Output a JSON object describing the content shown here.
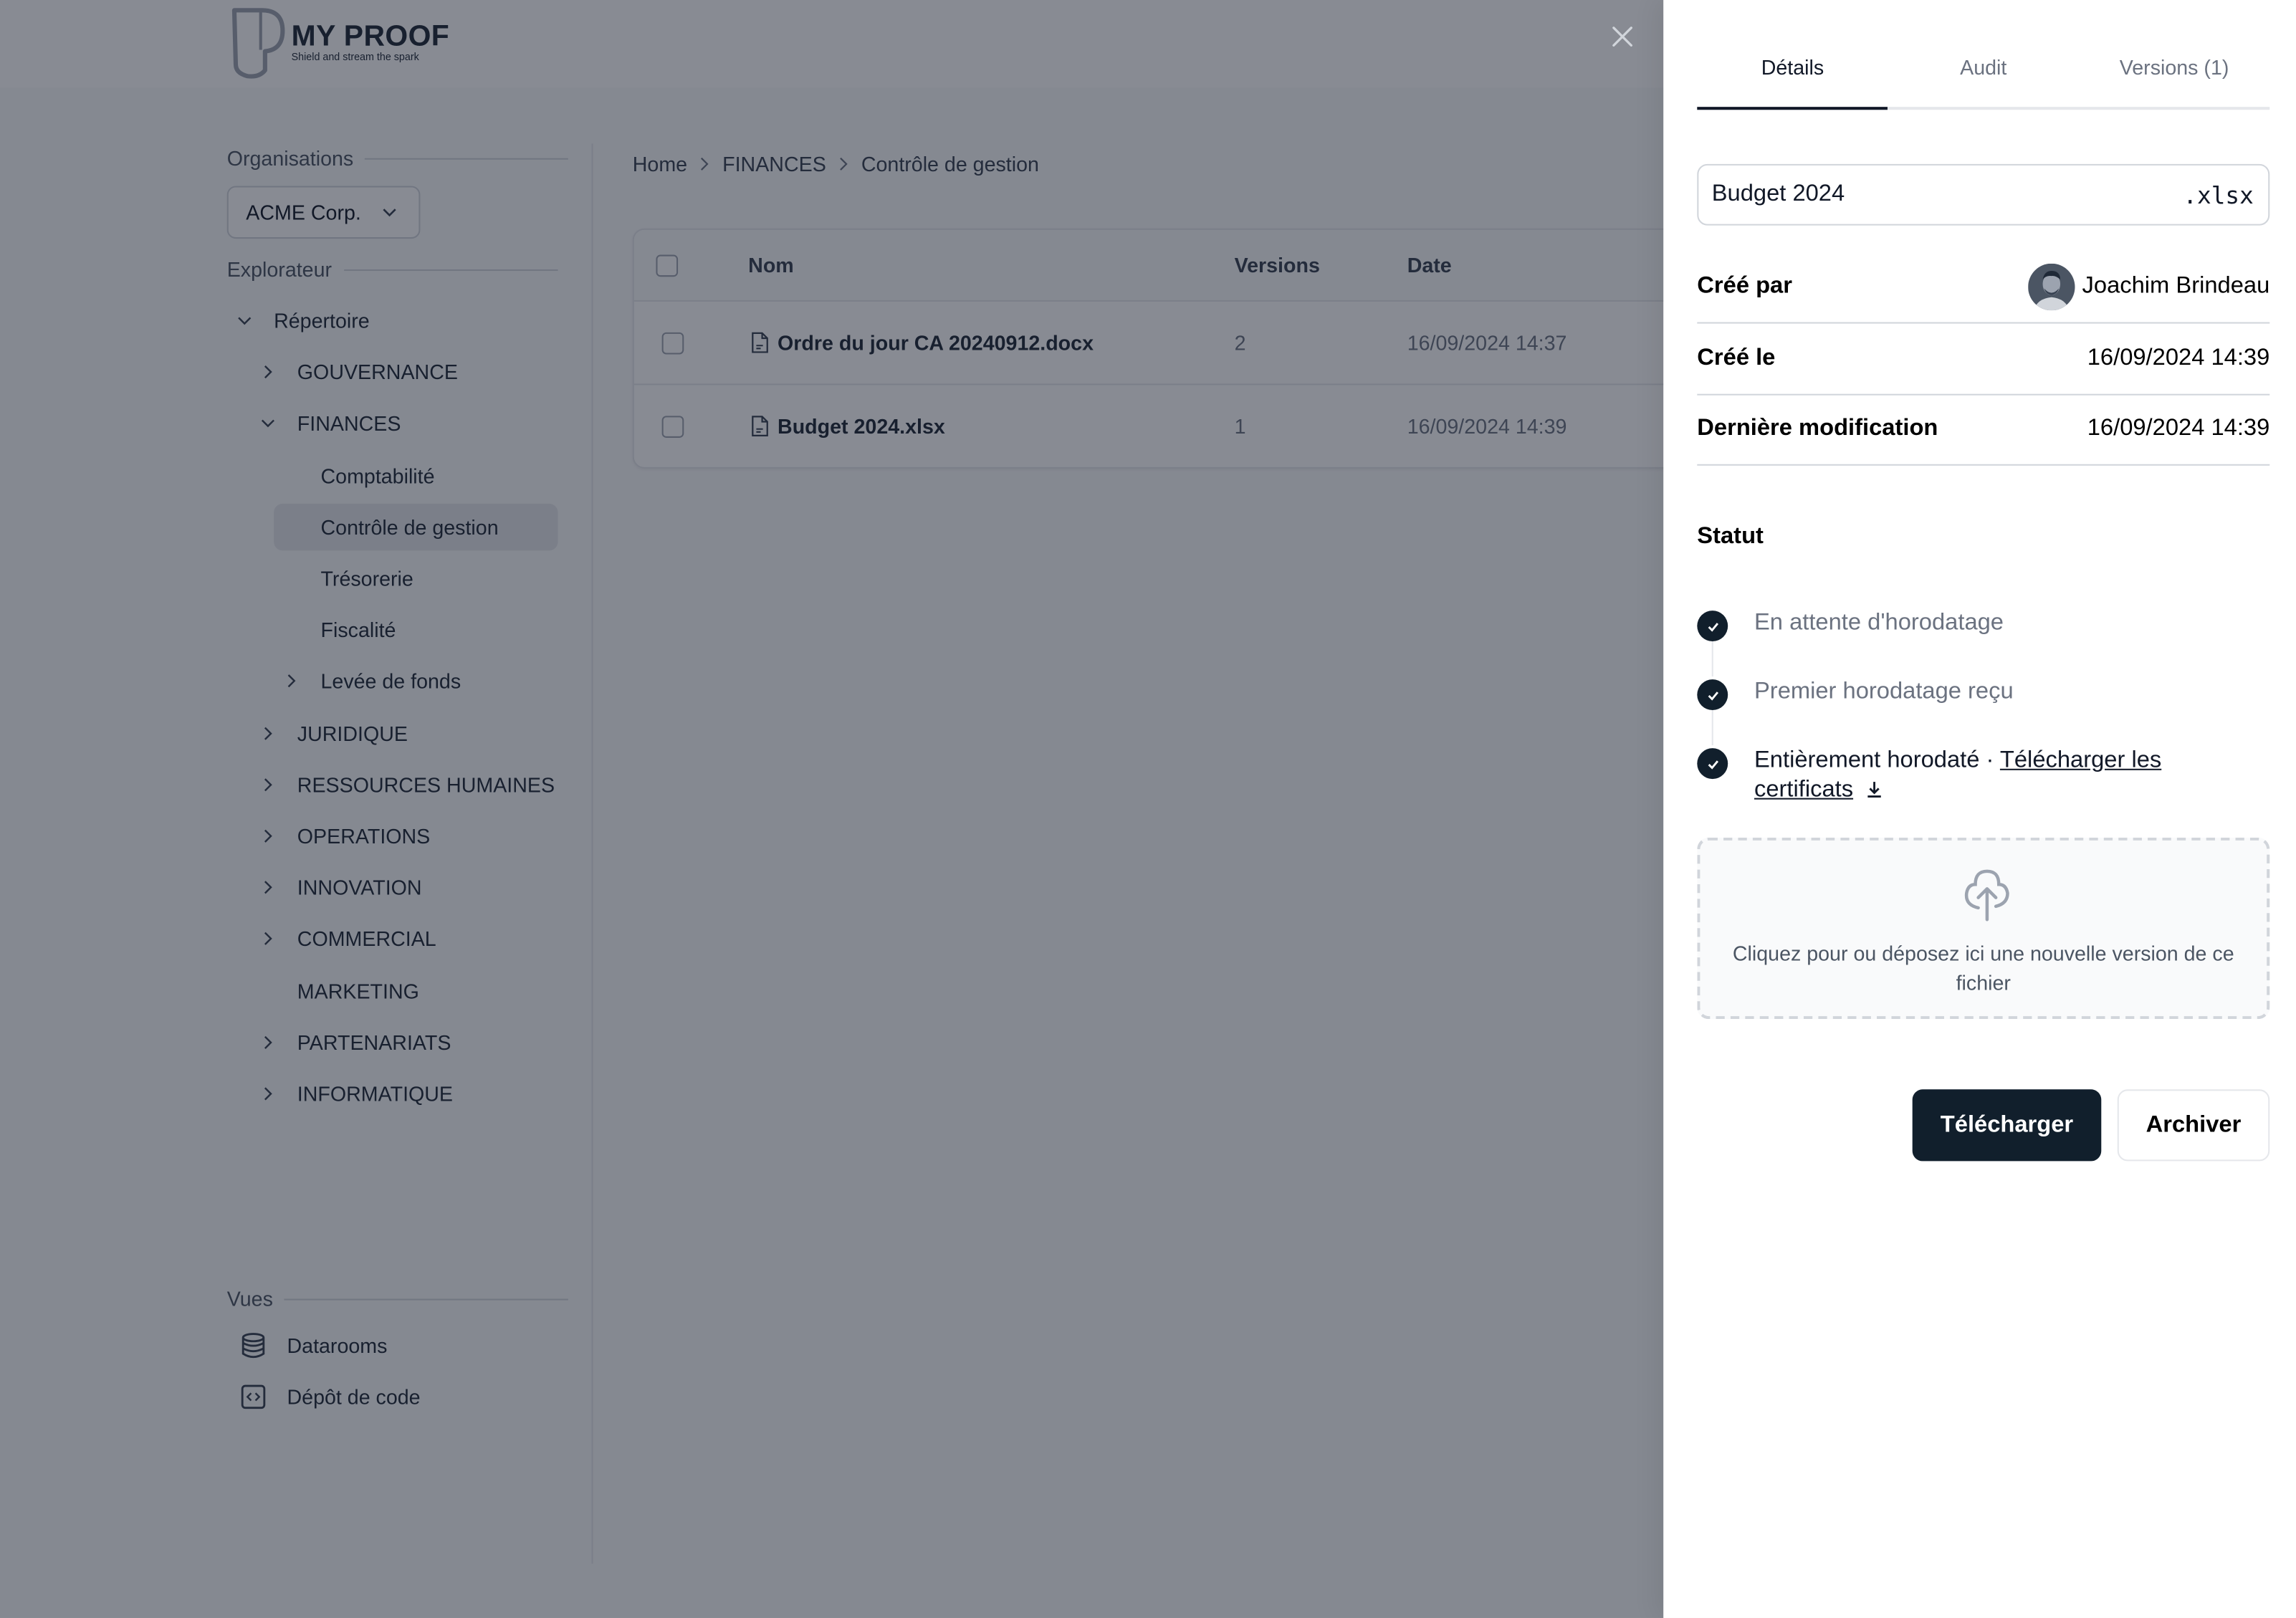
{
  "brand": {
    "name": "MY PROOF",
    "tagline": "Shield and stream the spark"
  },
  "sidebar": {
    "organisations_label": "Organisations",
    "organisation_selected": "ACME Corp.",
    "explorer_label": "Explorateur",
    "tree": [
      {
        "label": "Répertoire",
        "level": 0,
        "chevron": "down"
      },
      {
        "label": "GOUVERNANCE",
        "level": 1,
        "chevron": "right"
      },
      {
        "label": "FINANCES",
        "level": 1,
        "chevron": "down"
      },
      {
        "label": "Comptabilité",
        "level": 2,
        "chevron": "none"
      },
      {
        "label": "Contrôle de gestion",
        "level": 2,
        "chevron": "none",
        "active": true
      },
      {
        "label": "Trésorerie",
        "level": 2,
        "chevron": "none"
      },
      {
        "label": "Fiscalité",
        "level": 2,
        "chevron": "none"
      },
      {
        "label": "Levée de fonds",
        "level": 2,
        "chevron": "right"
      },
      {
        "label": "JURIDIQUE",
        "level": 1,
        "chevron": "right"
      },
      {
        "label": "RESSOURCES HUMAINES",
        "level": 1,
        "chevron": "right"
      },
      {
        "label": "OPERATIONS",
        "level": 1,
        "chevron": "right"
      },
      {
        "label": "INNOVATION",
        "level": 1,
        "chevron": "right"
      },
      {
        "label": "COMMERCIAL",
        "level": 1,
        "chevron": "right"
      },
      {
        "label": "MARKETING",
        "level": 1,
        "chevron": "none"
      },
      {
        "label": "PARTENARIATS",
        "level": 1,
        "chevron": "right"
      },
      {
        "label": "INFORMATIQUE",
        "level": 1,
        "chevron": "right"
      }
    ],
    "views_label": "Vues",
    "views": [
      {
        "label": "Datarooms",
        "icon": "database-icon"
      },
      {
        "label": "Dépôt de code",
        "icon": "code-icon"
      }
    ]
  },
  "breadcrumb": [
    "Home",
    "FINANCES",
    "Contrôle de gestion"
  ],
  "table": {
    "columns": [
      "Nom",
      "Versions",
      "Date"
    ],
    "rows": [
      {
        "name": "Ordre du jour CA 20240912.docx",
        "versions": "2",
        "date": "16/09/2024 14:37"
      },
      {
        "name": "Budget 2024.xlsx",
        "versions": "1",
        "date": "16/09/2024 14:39"
      }
    ]
  },
  "panel": {
    "tabs": [
      {
        "label": "Détails",
        "active": true
      },
      {
        "label": "Audit",
        "active": false
      },
      {
        "label": "Versions (1)",
        "active": false
      }
    ],
    "file_name": "Budget 2024",
    "file_ext": ".xlsx",
    "meta": [
      {
        "label": "Créé par",
        "value": "Joachim Brindeau"
      },
      {
        "label": "Créé le",
        "value": "16/09/2024 14:39"
      },
      {
        "label": "Dernière modification",
        "value": "16/09/2024 14:39"
      }
    ],
    "status_title": "Statut",
    "steps": [
      {
        "label": "En attente d'horodatage",
        "done": true
      },
      {
        "label": "Premier horodatage reçu",
        "done": true
      },
      {
        "label": "Entièrement horodaté",
        "separator": " · ",
        "link": "Télécharger les certificats",
        "done": true
      }
    ],
    "dropzone_text": "Cliquez pour ou déposez ici une nouvelle version de ce fichier",
    "download_button": "Télécharger",
    "archive_button": "Archiver"
  },
  "colors": {
    "primary": "#111f2c",
    "overlay": "rgba(17,24,39,0.5)"
  }
}
